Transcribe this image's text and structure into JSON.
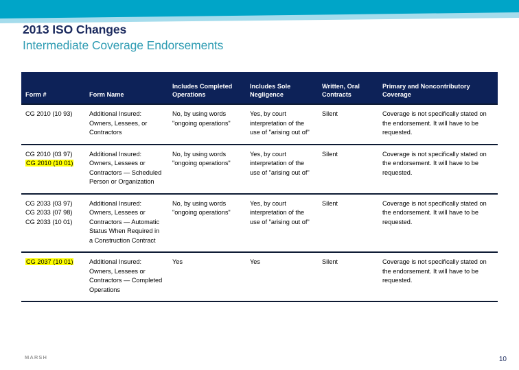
{
  "slide": {
    "title": "2013 ISO Changes",
    "subtitle": "Intermediate Coverage Endorsements",
    "page_number": "10",
    "footer_logo": "MARSH"
  },
  "colors": {
    "banner_dark": "#00a5c8",
    "banner_light": "#a5dcec",
    "title": "#1b2a5e",
    "subtitle": "#2f9cb3",
    "table_header_bg": "#0d2258",
    "highlight": "#ffff00",
    "rule": "#0d1a33"
  },
  "table": {
    "headers": [
      "Form #",
      "Form Name",
      "Includes Completed Operations",
      "Includes Sole Negligence",
      "Written, Oral Contracts",
      "Primary and Noncontributory Coverage"
    ],
    "rows": [
      {
        "forms": [
          {
            "text": "CG 2010 (10 93)",
            "highlighted": false
          }
        ],
        "form_name": "Additional Insured: Owners, Lessees, or Contractors",
        "includes_completed_operations": "No, by using words \"ongoing operations\"",
        "includes_sole_negligence": "Yes, by court interpretation of the use of \"arising out of\"",
        "written_oral_contracts": "Silent",
        "primary_noncontributory": "Coverage is not specifically stated on the endorsement. It will have to be requested."
      },
      {
        "forms": [
          {
            "text": "CG 2010 (03 97)",
            "highlighted": false
          },
          {
            "text": "CG 2010 (10 01)",
            "highlighted": true
          }
        ],
        "form_name": "Additional Insured: Owners, Lessees or Contractors — Scheduled Person or Organization",
        "includes_completed_operations": "No, by using words \"ongoing operations\"",
        "includes_sole_negligence": "Yes, by court interpretation of the use of \"arising out of\"",
        "written_oral_contracts": "Silent",
        "primary_noncontributory": "Coverage is not specifically stated on the endorsement. It will have to be requested."
      },
      {
        "forms": [
          {
            "text": "CG 2033 (03 97)",
            "highlighted": false
          },
          {
            "text": "CG 2033 (07 98)",
            "highlighted": false
          },
          {
            "text": "CG 2033 (10 01)",
            "highlighted": false
          }
        ],
        "form_name": "Additional Insured: Owners, Lessees or Contractors — Automatic Status When Required in a Construction Contract",
        "includes_completed_operations": "No, by using words \"ongoing operations\"",
        "includes_sole_negligence": "Yes, by court interpretation of the use of \"arising out of\"",
        "written_oral_contracts": "Silent",
        "primary_noncontributory": "Coverage is not specifically stated on the endorsement. It will have to be requested."
      },
      {
        "forms": [
          {
            "text": "CG 2037 (10 01)",
            "highlighted": true
          }
        ],
        "form_name": "Additional Insured: Owners, Lessees or Contractors — Completed Operations",
        "includes_completed_operations": "Yes",
        "includes_sole_negligence": "Yes",
        "written_oral_contracts": "Silent",
        "primary_noncontributory": "Coverage is not specifically stated on the endorsement. It will have to be requested."
      }
    ]
  }
}
